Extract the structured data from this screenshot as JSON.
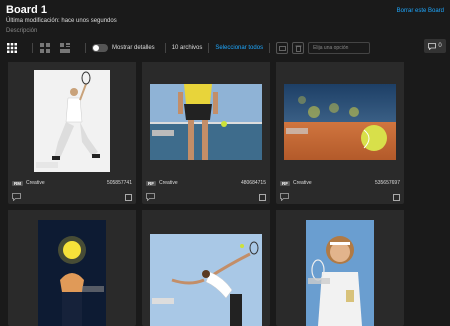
{
  "board": {
    "title": "Board 1",
    "last_modified": "Última modificación: hace unos segundos",
    "description": "Descripción",
    "delete_label": "Borrar este Board"
  },
  "toolbar": {
    "show_details_label": "Mostrar detalles",
    "file_count": "10 archivos",
    "select_all_label": "Seleccionar todos",
    "action_placeholder": "Elija una opción"
  },
  "comments": {
    "count": "0"
  },
  "cards": [
    {
      "badge": "RM",
      "license": "Creative",
      "id": "505857741"
    },
    {
      "badge": "RF",
      "license": "Creative",
      "id": "480684715"
    },
    {
      "badge": "RF",
      "license": "Creative",
      "id": "535657697"
    },
    {
      "badge": "",
      "license": "",
      "id": ""
    },
    {
      "badge": "",
      "license": "",
      "id": ""
    },
    {
      "badge": "",
      "license": "",
      "id": ""
    }
  ]
}
